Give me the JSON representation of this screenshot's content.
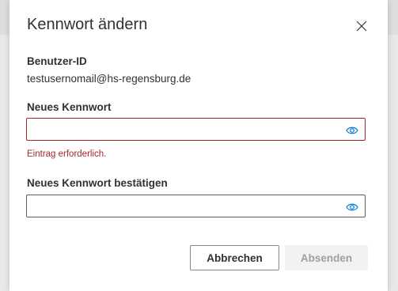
{
  "dialog": {
    "title": "Kennwort ändern",
    "close_icon": "close-icon"
  },
  "user": {
    "label": "Benutzer-ID",
    "value": "testusernomail@hs-regensburg.de"
  },
  "new_password": {
    "label": "Neues Kennwort",
    "value": "",
    "error": "Eintrag erforderlich.",
    "reveal_icon": "eye-icon"
  },
  "confirm_password": {
    "label": "Neues Kennwort bestätigen",
    "value": "",
    "reveal_icon": "eye-icon"
  },
  "buttons": {
    "cancel": "Abbrechen",
    "submit": "Absenden"
  },
  "colors": {
    "error": "#a4262c",
    "accent": "#0078d4",
    "disabled_text": "#a19f9d"
  }
}
